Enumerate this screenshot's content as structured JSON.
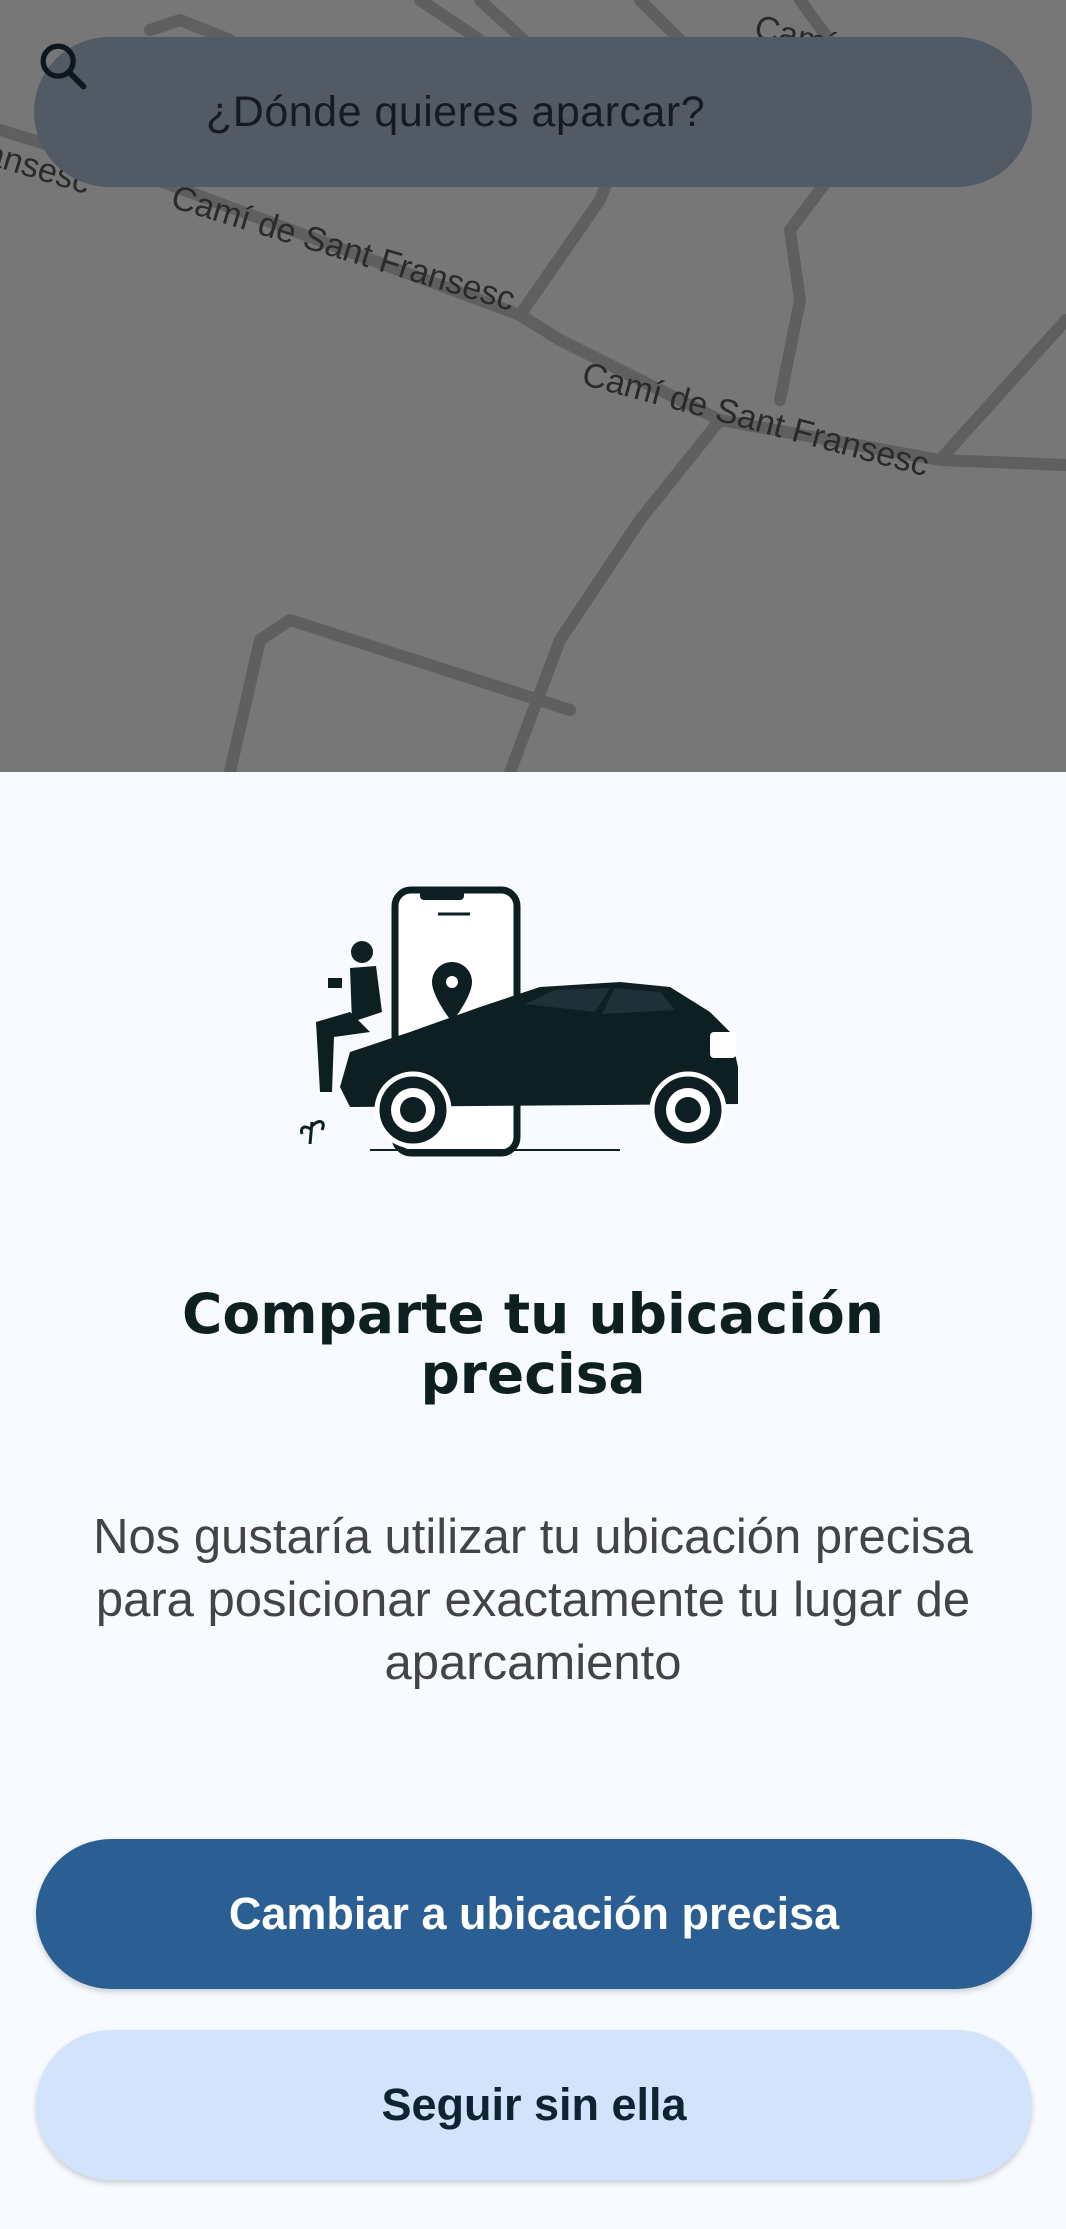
{
  "search": {
    "placeholder": "¿Dónde quieres aparcar?",
    "icon": "search-icon"
  },
  "map": {
    "streets": [
      "Camí de Sant Fransesc",
      "Camí de Sant Fransesc",
      "Camí de les",
      "ansesc"
    ]
  },
  "sheet": {
    "illustration": "car-phone-location-illustration",
    "title": "Comparte tu ubicación precisa",
    "description": "Nos gustaría utilizar tu ubicación precisa para posicionar exactamente tu lugar de aparcamiento",
    "primary_button": "Cambiar a ubicación precisa",
    "secondary_button": "Seguir sin ella"
  },
  "colors": {
    "primary": "#2b5f93",
    "secondary": "#d3e3fb",
    "illustration": "#0e1f24"
  }
}
